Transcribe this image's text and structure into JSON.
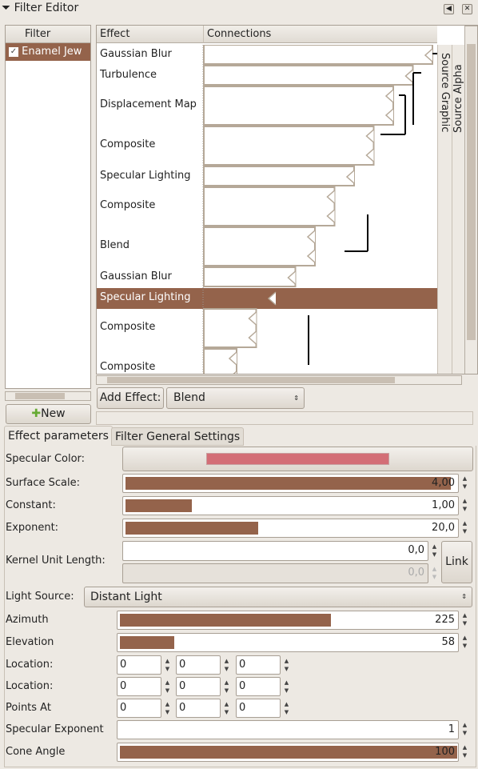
{
  "window": {
    "title": "Filter Editor",
    "icons": [
      "funnel-icon",
      "restore-icon",
      "close-icon"
    ]
  },
  "filters": {
    "header": "Filter",
    "items": [
      {
        "label": "Enamel Jew",
        "checked": true
      }
    ],
    "new_label": "New"
  },
  "effects": {
    "header_effect": "Effect",
    "header_connections": "Connections",
    "rows": [
      {
        "label": "Gaussian Blur",
        "inputs": 1
      },
      {
        "label": "Turbulence",
        "inputs": 1
      },
      {
        "label": "Displacement Map",
        "inputs": 2
      },
      {
        "label": "Composite",
        "inputs": 2
      },
      {
        "label": "Specular Lighting",
        "inputs": 1
      },
      {
        "label": "Composite",
        "inputs": 2
      },
      {
        "label": "Blend",
        "inputs": 2
      },
      {
        "label": "Gaussian Blur",
        "inputs": 1
      },
      {
        "label": "Specular Lighting",
        "inputs": 1,
        "selected": true
      },
      {
        "label": "Composite",
        "inputs": 2
      },
      {
        "label": "Composite",
        "inputs": 2
      }
    ],
    "sources": [
      "Source Graphic",
      "Source Alpha"
    ]
  },
  "add_effect": {
    "label": "Add Effect:",
    "selected": "Blend"
  },
  "tabs": [
    {
      "label": "Effect parameters",
      "active": true
    },
    {
      "label": "Filter General Settings"
    }
  ],
  "params": {
    "specular_color": {
      "label": "Specular Color:",
      "color": "#d36e76"
    },
    "surface_scale": {
      "label": "Surface Scale:",
      "value": "4,00",
      "fraction": 0.98
    },
    "constant": {
      "label": "Constant:",
      "value": "1,00",
      "fraction": 0.2
    },
    "exponent": {
      "label": "Exponent:",
      "value": "20,0",
      "fraction": 0.4
    },
    "kernel": {
      "label": "Kernel Unit Length:",
      "value1": "0,0",
      "value2": "0,0",
      "link": "Link"
    },
    "light_source": {
      "label": "Light Source:",
      "value": "Distant Light"
    },
    "azimuth": {
      "label": "Azimuth",
      "value": "225",
      "fraction": 0.625
    },
    "elevation": {
      "label": "Elevation",
      "value": "58",
      "fraction": 0.16
    },
    "location1": {
      "label": "Location:",
      "values": [
        "0",
        "0",
        "0"
      ]
    },
    "location2": {
      "label": "Location:",
      "values": [
        "0",
        "0",
        "0"
      ]
    },
    "points_at": {
      "label": "Points At",
      "values": [
        "0",
        "0",
        "0"
      ]
    },
    "specular_exponent": {
      "label": "Specular Exponent",
      "value": "1",
      "fraction": 0
    },
    "cone_angle": {
      "label": "Cone Angle",
      "value": "100",
      "fraction": 1
    }
  },
  "colors": {
    "selection": "#94634b",
    "accent": "#94634b"
  }
}
